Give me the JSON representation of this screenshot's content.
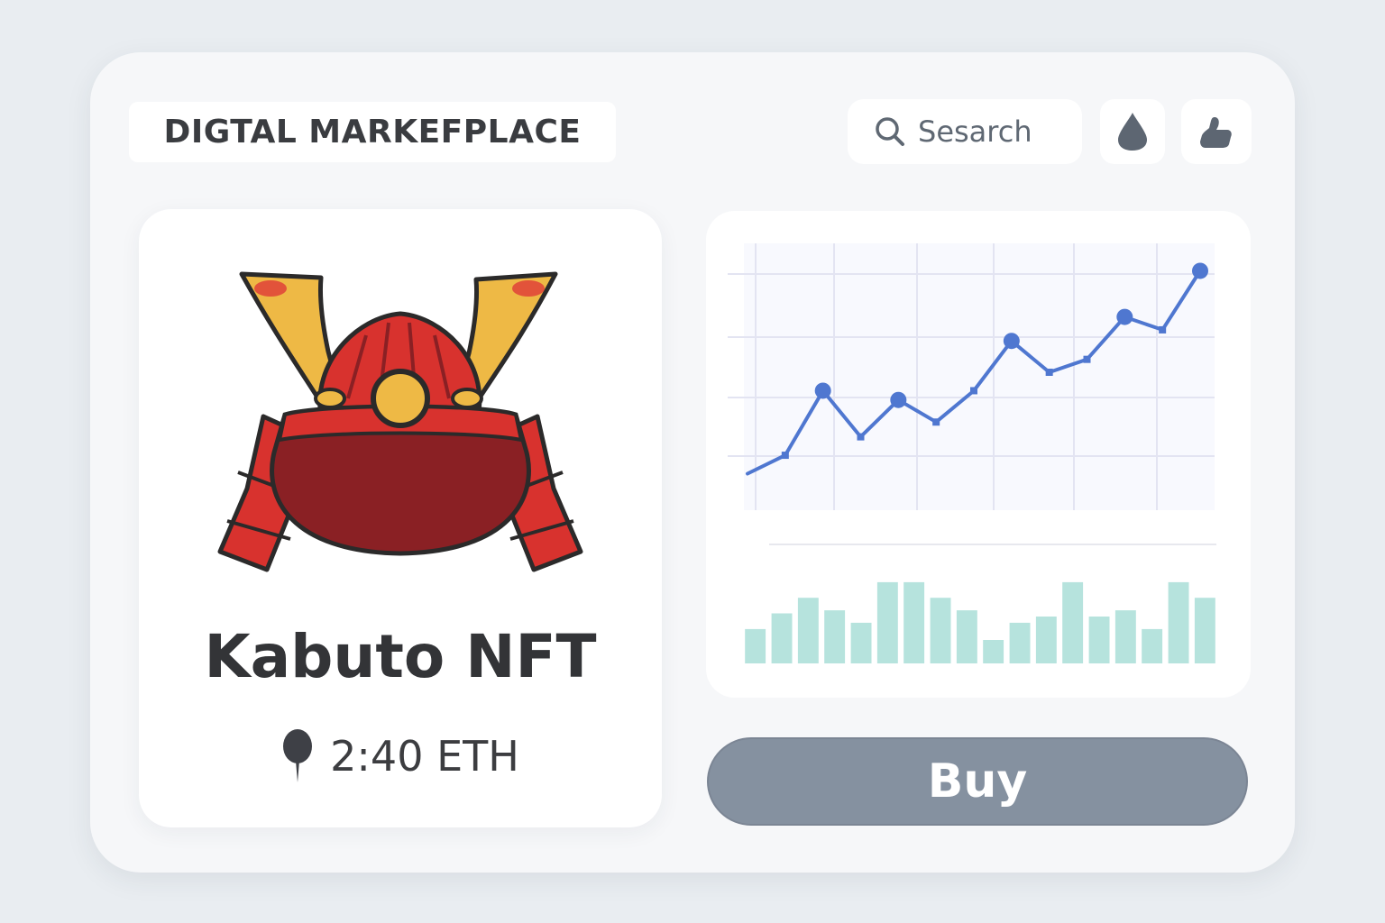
{
  "header": {
    "title": "DIGTAL MARKEFPLACE",
    "search_label": "Sesarch",
    "icons": [
      "search-icon",
      "drop-icon",
      "hand-icon"
    ]
  },
  "nft": {
    "name": "Kabuto NFT",
    "price": "2:40 ETH",
    "image": "samurai-kabuto-helmet",
    "price_icon": "pin-icon"
  },
  "buy_button": {
    "label": "Buy"
  },
  "colors": {
    "line": "#4f77d0",
    "bars": "#b6e3dd",
    "button": "#8591a0",
    "helmet_red": "#d8322e",
    "helmet_dark": "#8a2024",
    "helmet_gold": "#eeb945"
  },
  "chart_data": [
    {
      "type": "line",
      "x": [
        1,
        2,
        3,
        4,
        5,
        6,
        7,
        8,
        9,
        10,
        11,
        12,
        13
      ],
      "y": [
        10,
        20,
        55,
        30,
        50,
        38,
        55,
        82,
        65,
        72,
        95,
        88,
        120
      ],
      "markers": [
        false,
        false,
        true,
        false,
        true,
        false,
        false,
        true,
        false,
        false,
        true,
        false,
        true
      ],
      "ylim": [
        0,
        130
      ],
      "grid": true
    },
    {
      "type": "bar",
      "values": [
        22,
        32,
        42,
        34,
        26,
        52,
        52,
        42,
        34,
        15,
        26,
        30,
        52,
        30,
        34,
        22,
        52,
        42
      ],
      "ylim": [
        0,
        60
      ],
      "grid": false
    }
  ]
}
